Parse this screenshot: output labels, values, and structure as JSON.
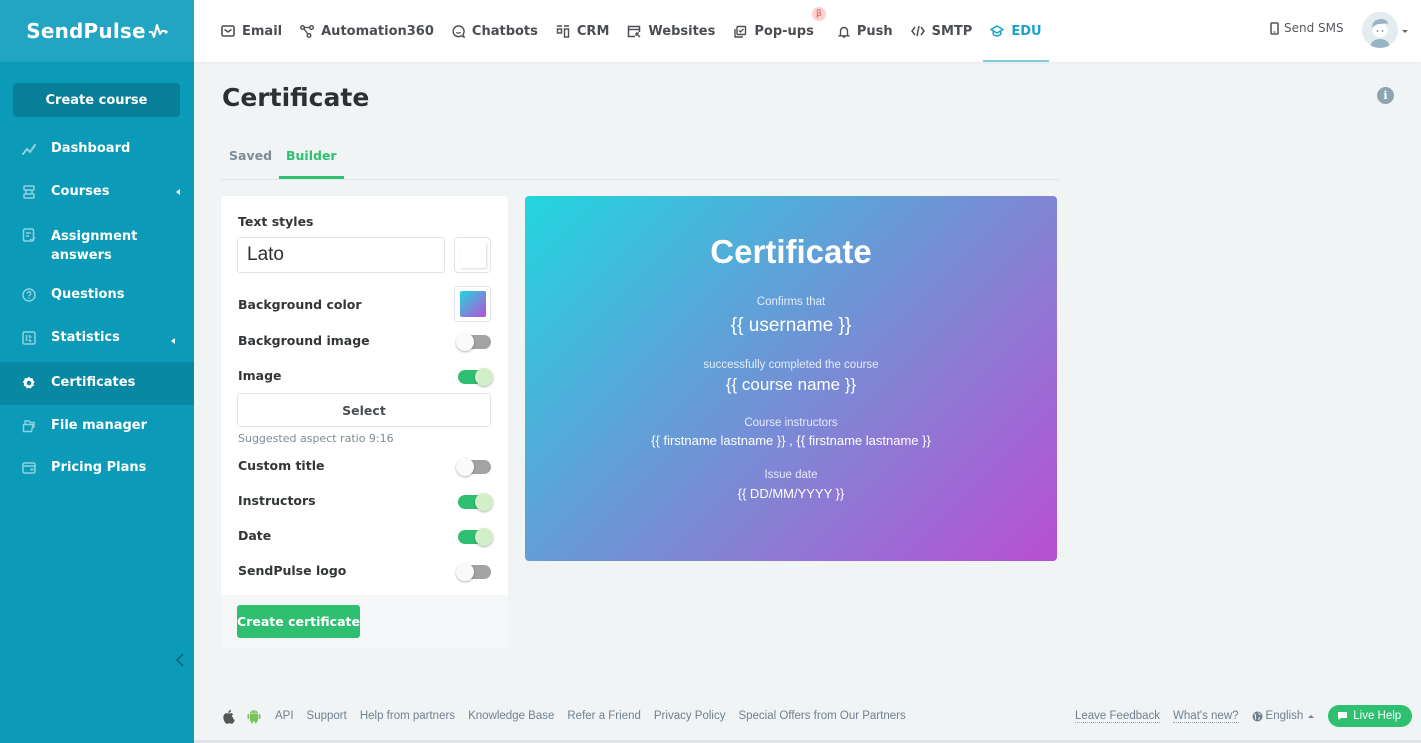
{
  "brand": {
    "name": "SendPulse",
    "color": "#22a5c3",
    "sidebar_color": "#0b9ab8"
  },
  "topnav": {
    "items": [
      {
        "label": "Email",
        "icon": "envelope-icon"
      },
      {
        "label": "Automation360",
        "icon": "flow-icon"
      },
      {
        "label": "Chatbots",
        "icon": "chat-icon"
      },
      {
        "label": "CRM",
        "icon": "crm-icon"
      },
      {
        "label": "Websites",
        "icon": "website-icon"
      },
      {
        "label": "Pop-ups",
        "icon": "popup-icon",
        "badge": "β"
      },
      {
        "label": "Push",
        "icon": "bell-icon"
      },
      {
        "label": "SMTP",
        "icon": "code-icon"
      },
      {
        "label": "EDU",
        "icon": "graduation-cap-icon",
        "active": true
      }
    ],
    "send_sms": "Send SMS"
  },
  "sidebar": {
    "create_course": "Create course",
    "items": [
      {
        "label": "Dashboard",
        "icon": "chart-line-icon"
      },
      {
        "label": "Courses",
        "icon": "courses-icon",
        "has_submenu": true
      },
      {
        "label": "Assignment answers",
        "icon": "assignment-icon"
      },
      {
        "label": "Questions",
        "icon": "question-icon"
      },
      {
        "label": "Statistics",
        "icon": "statistics-icon",
        "has_submenu": true
      },
      {
        "label": "Certificates",
        "icon": "gear-icon",
        "active": true
      },
      {
        "label": "File manager",
        "icon": "folder-icon"
      },
      {
        "label": "Pricing Plans",
        "icon": "wallet-icon"
      }
    ]
  },
  "page": {
    "title": "Certificate",
    "tabs": [
      {
        "label": "Saved",
        "active": false
      },
      {
        "label": "Builder",
        "active": true
      }
    ]
  },
  "builder": {
    "text_styles_label": "Text styles",
    "font_value": "Lato",
    "text_color": "#ffffff",
    "background_color_label": "Background color",
    "background_gradient": [
      "#22d6df",
      "#b94fd3"
    ],
    "background_image_label": "Background image",
    "background_image_on": false,
    "image_label": "Image",
    "image_on": true,
    "select_label": "Select",
    "aspect_hint": "Suggested aspect ratio 9:16",
    "custom_title_label": "Custom title",
    "custom_title_on": false,
    "instructors_label": "Instructors",
    "instructors_on": true,
    "date_label": "Date",
    "date_on": true,
    "logo_label": "SendPulse logo",
    "logo_on": false,
    "create_button": "Create certificate"
  },
  "certificate": {
    "title": "Certificate",
    "confirms": "Confirms that",
    "username": "{{ username }}",
    "completed": "successfully completed the course",
    "course_name": "{{ course name }}",
    "instructors_label": "Course instructors",
    "instructors": "{{ firstname lastname }} , {{ firstname lastname }}",
    "issue_date_label": "Issue date",
    "issue_date": "{{ DD/MM/YYYY }}"
  },
  "footer": {
    "links": [
      "API",
      "Support",
      "Help from partners",
      "Knowledge Base",
      "Refer a Friend",
      "Privacy Policy",
      "Special Offers from Our Partners"
    ],
    "leave_feedback": "Leave Feedback",
    "whats_new": "What's new?",
    "language": "English",
    "live_help": "Live Help"
  }
}
